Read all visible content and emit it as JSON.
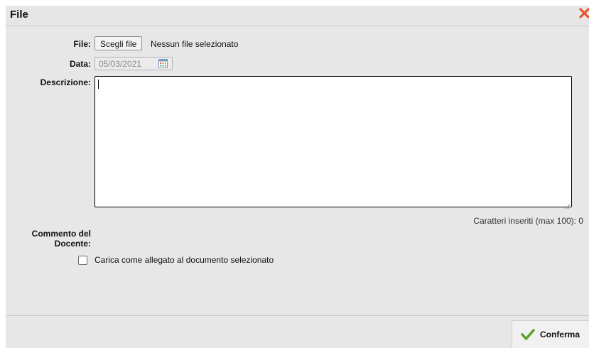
{
  "dialog": {
    "title": "File",
    "close_icon": "close-x-icon",
    "accent_color": "#e8552a"
  },
  "form": {
    "file_label": "File:",
    "file_button_label": "Scegli file",
    "file_status": "Nessun file selezionato",
    "date_label": "Data:",
    "date_value": "05/03/2021",
    "description_label": "Descrizione:",
    "description_value": "",
    "char_count": "Caratteri inseriti (max 100): 0",
    "comment_label_line1": "Commento del",
    "comment_label_line2": "Docente:",
    "attach_checkbox_label": "Carica come allegato al documento selezionato",
    "attach_checked": false
  },
  "footer": {
    "confirm_label": "Conferma",
    "confirm_icon": "checkmark-icon",
    "confirm_icon_color": "#5aa02c"
  }
}
